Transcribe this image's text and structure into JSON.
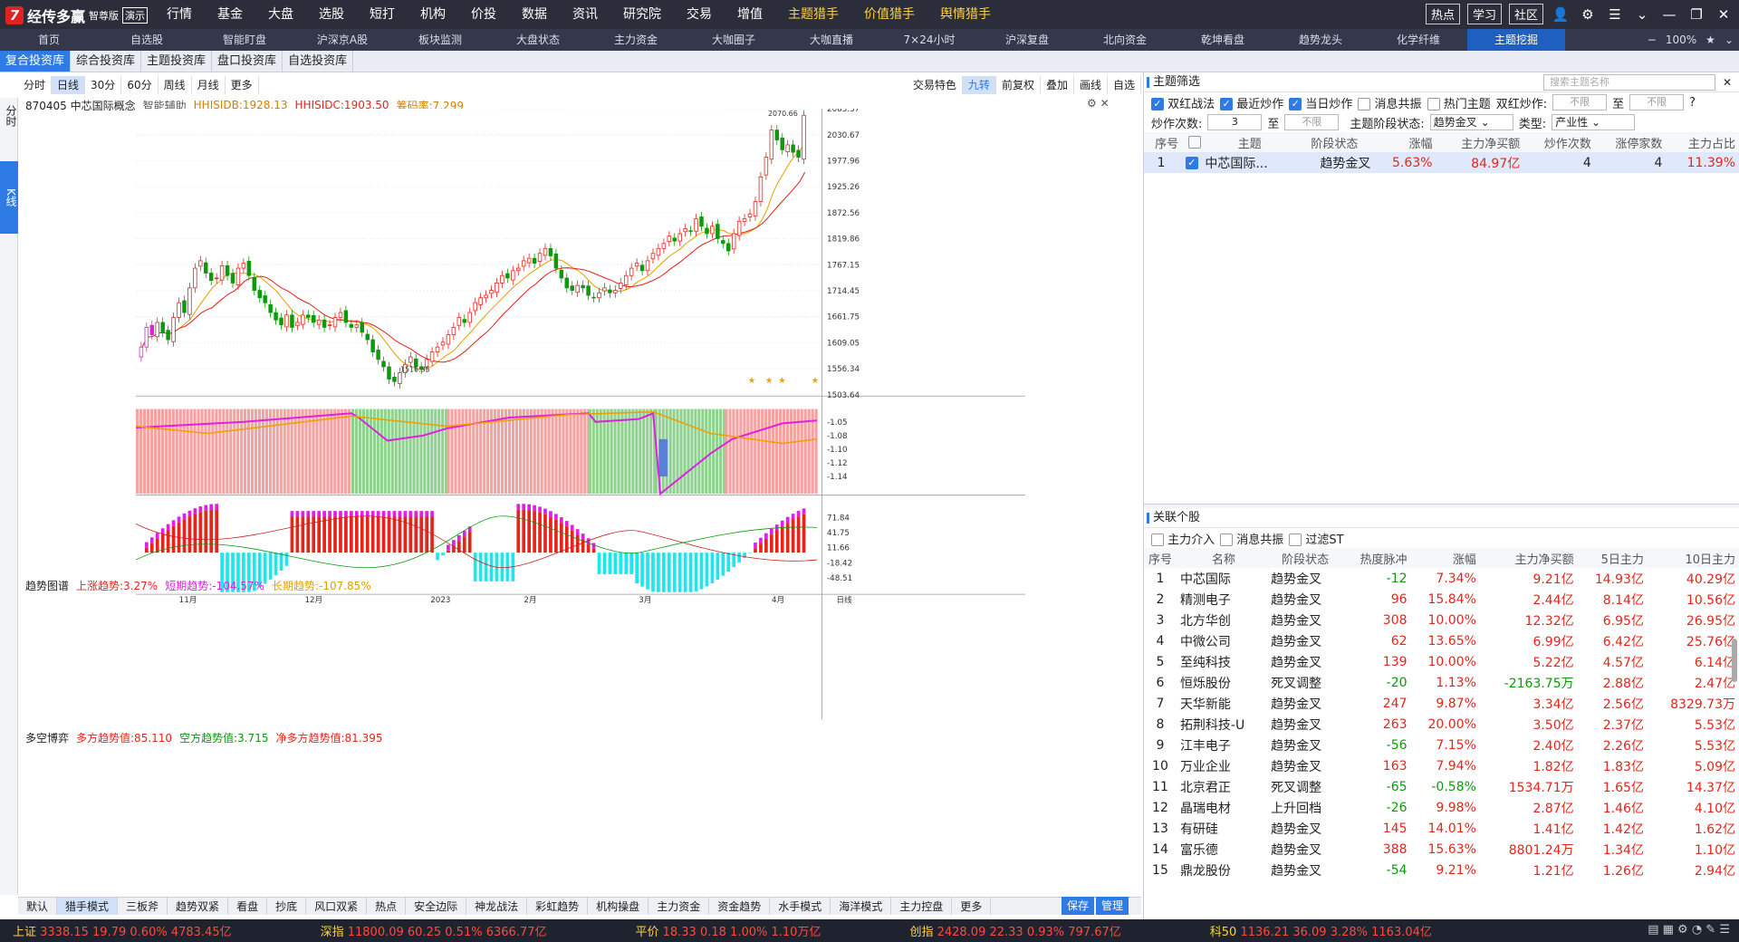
{
  "app": {
    "title": "经传多赢",
    "edition": "智尊版",
    "demo": "演示"
  },
  "topmenu": [
    "行情",
    "基金",
    "大盘",
    "选股",
    "短打",
    "机构",
    "价投",
    "数据",
    "资讯",
    "研究院",
    "交易",
    "增值",
    "主题猎手",
    "价值猎手",
    "舆情猎手"
  ],
  "topmenu_highlight": [
    "主题猎手",
    "价值猎手",
    "舆情猎手"
  ],
  "topright": [
    "热点",
    "学习",
    "社区"
  ],
  "navtabs": [
    "首页",
    "自选股",
    "智能盯盘",
    "沪深京A股",
    "板块监测",
    "大盘状态",
    "主力资金",
    "大咖圈子",
    "大咖直播",
    "7×24小时",
    "沪深复盘",
    "北向资金",
    "乾坤看盘",
    "趋势龙头",
    "化学纤维",
    "主题挖掘"
  ],
  "nav_zoom": "100%",
  "subtabs": [
    "复合投资库",
    "综合投资库",
    "主题投资库",
    "盘口投资库",
    "自选投资库"
  ],
  "side": {
    "tab1": "分时",
    "tab2": "K线"
  },
  "periods": [
    "分时",
    "日线",
    "30分",
    "60分",
    "周线",
    "月线",
    "更多"
  ],
  "active_period": "日线",
  "chart_tools": [
    "交易特色",
    "九转",
    "前复权",
    "叠加",
    "画线",
    "自选"
  ],
  "chart_info": {
    "code": "870405 中芯国际概念",
    "assist": "智能辅助",
    "l1": "HHJSJDB:1928.13",
    "l2": "HHJSJDC:1903.50",
    "l3": "筹码率:7.299"
  },
  "pane2": {
    "name": "趋势图谱",
    "l1": "上涨趋势:3.27%",
    "l2": "短期趋势:-104.57%",
    "l3": "长期趋势:-107.85%"
  },
  "pane3": {
    "name": "多空博弈",
    "l1": "多方趋势值:85.110",
    "l2": "空方趋势值:3.715",
    "l3": "净多方趋势值:81.395"
  },
  "price_axis": [
    "2083.37",
    "2030.67",
    "1977.96",
    "1925.26",
    "1872.56",
    "1819.86",
    "1767.15",
    "1714.45",
    "1661.75",
    "1609.05",
    "1556.34",
    "1503.64"
  ],
  "trend_axis": [
    "-1.05",
    "-1.08",
    "-1.10",
    "-1.12",
    "-1.14"
  ],
  "game_axis": [
    "71.84",
    "41.75",
    "11.66",
    "-18.42",
    "-48.51"
  ],
  "high_label": "2070.66",
  "low_label": "1516.35",
  "x_labels": [
    "11月",
    "12月",
    "2023",
    "2月",
    "3月",
    "4月"
  ],
  "x_mode": "日线",
  "bottomtabs": [
    "默认",
    "猎手模式",
    "三板斧",
    "趋势双紧",
    "看盘",
    "抄底",
    "风口双紧",
    "热点",
    "安全边际",
    "神龙战法",
    "彩虹趋势",
    "机构操盘",
    "主力资金",
    "资金趋势",
    "水手模式",
    "海洋模式",
    "主力控盘",
    "更多"
  ],
  "bottom_active": "猎手模式",
  "bottom_buttons": [
    "保存",
    "管理"
  ],
  "right": {
    "section1": "主题筛选",
    "search_placeholder": "搜索主题名称",
    "filters": [
      {
        "label": "双红战法",
        "on": true
      },
      {
        "label": "最近炒作",
        "on": true
      },
      {
        "label": "当日炒作",
        "on": true
      },
      {
        "label": "消息共振",
        "on": false
      },
      {
        "label": "热门主题",
        "on": false
      }
    ],
    "double_red": "双红炒作:",
    "none": "不限",
    "to": "至",
    "count_label": "炒作次数:",
    "count_value": "3",
    "stage_label": "主题阶段状态:",
    "stage_value": "趋势金叉",
    "type_label": "类型:",
    "type_value": "产业性",
    "theme_headers": [
      "序号",
      "",
      "主题",
      "阶段状态",
      "涨幅",
      "主力净买额",
      "炒作次数",
      "涨停家数",
      "主力占比"
    ],
    "theme_rows": [
      [
        "1",
        "",
        "中芯国际...",
        "趋势金叉",
        "5.63%",
        "84.97亿",
        "4",
        "4",
        "11.39%"
      ]
    ],
    "section2": "关联个股",
    "filters2": [
      {
        "label": "主力介入",
        "on": false
      },
      {
        "label": "消息共振",
        "on": false
      },
      {
        "label": "过滤ST",
        "on": false
      }
    ],
    "stock_headers": [
      "序号",
      "名称",
      "阶段状态",
      "热度脉冲",
      "涨幅",
      "主力净买额",
      "5日主力",
      "10日主力"
    ],
    "stock_rows": [
      [
        "1",
        "中芯国际",
        "趋势金叉",
        "-12",
        "7.34%",
        "9.21亿",
        "14.93亿",
        "40.29亿"
      ],
      [
        "2",
        "精测电子",
        "趋势金叉",
        "96",
        "15.84%",
        "2.44亿",
        "8.14亿",
        "10.56亿"
      ],
      [
        "3",
        "北方华创",
        "趋势金叉",
        "308",
        "10.00%",
        "12.32亿",
        "6.95亿",
        "26.95亿"
      ],
      [
        "4",
        "中微公司",
        "趋势金叉",
        "62",
        "13.65%",
        "6.99亿",
        "6.42亿",
        "25.76亿"
      ],
      [
        "5",
        "至纯科技",
        "趋势金叉",
        "139",
        "10.00%",
        "5.22亿",
        "4.57亿",
        "6.14亿"
      ],
      [
        "6",
        "恒烁股份",
        "死叉调整",
        "-20",
        "1.13%",
        "-2163.75万",
        "2.88亿",
        "2.47亿"
      ],
      [
        "7",
        "天华新能",
        "趋势金叉",
        "247",
        "9.87%",
        "3.34亿",
        "2.56亿",
        "8329.73万"
      ],
      [
        "8",
        "拓荆科技-U",
        "趋势金叉",
        "263",
        "20.00%",
        "3.50亿",
        "2.37亿",
        "5.53亿"
      ],
      [
        "9",
        "江丰电子",
        "趋势金叉",
        "-56",
        "7.15%",
        "2.40亿",
        "2.26亿",
        "5.53亿"
      ],
      [
        "10",
        "万业企业",
        "趋势金叉",
        "163",
        "7.94%",
        "1.82亿",
        "1.83亿",
        "5.09亿"
      ],
      [
        "11",
        "北京君正",
        "死叉调整",
        "-65",
        "-0.58%",
        "1534.71万",
        "1.65亿",
        "14.37亿"
      ],
      [
        "12",
        "晶瑞电材",
        "上升回档",
        "-26",
        "9.98%",
        "2.87亿",
        "1.46亿",
        "4.10亿"
      ],
      [
        "13",
        "有研硅",
        "趋势金叉",
        "145",
        "14.01%",
        "1.41亿",
        "1.42亿",
        "1.62亿"
      ],
      [
        "14",
        "富乐德",
        "趋势金叉",
        "388",
        "15.63%",
        "8801.24万",
        "1.34亿",
        "1.10亿"
      ],
      [
        "15",
        "鼎龙股份",
        "趋势金叉",
        "-54",
        "9.21%",
        "1.21亿",
        "1.26亿",
        "2.94亿"
      ]
    ]
  },
  "status": [
    {
      "name": "上证",
      "price": "3338.15",
      "chg": "19.79",
      "pct": "0.60%",
      "amt": "4783.45亿",
      "c": "red"
    },
    {
      "name": "深指",
      "price": "11800.09",
      "chg": "60.25",
      "pct": "0.51%",
      "amt": "6366.77亿",
      "c": "red"
    },
    {
      "name": "平价",
      "price": "18.33",
      "chg": "0.18",
      "pct": "1.00%",
      "amt": "1.10万亿",
      "c": "red"
    },
    {
      "name": "创指",
      "price": "2428.09",
      "chg": "22.33",
      "pct": "0.93%",
      "amt": "797.67亿",
      "c": "red"
    },
    {
      "name": "科50",
      "price": "1136.21",
      "chg": "36.09",
      "pct": "3.28%",
      "amt": "1163.04亿",
      "c": "red"
    }
  ],
  "chart_data": {
    "type": "candlestick",
    "y_range": [
      1503.64,
      2083.37
    ],
    "closes": [
      1600,
      1640,
      1625,
      1650,
      1630,
      1615,
      1660,
      1690,
      1670,
      1720,
      1760,
      1775,
      1750,
      1735,
      1740,
      1765,
      1745,
      1730,
      1760,
      1770,
      1745,
      1715,
      1700,
      1690,
      1670,
      1655,
      1645,
      1665,
      1640,
      1650,
      1665,
      1660,
      1650,
      1655,
      1640,
      1645,
      1660,
      1670,
      1650,
      1640,
      1645,
      1630,
      1615,
      1590,
      1575,
      1560,
      1535,
      1530,
      1548,
      1565,
      1580,
      1560,
      1555,
      1575,
      1590,
      1600,
      1610,
      1625,
      1640,
      1660,
      1650,
      1670,
      1690,
      1700,
      1705,
      1715,
      1730,
      1745,
      1740,
      1755,
      1760,
      1775,
      1780,
      1770,
      1790,
      1800,
      1785,
      1760,
      1740,
      1720,
      1715,
      1725,
      1720,
      1705,
      1700,
      1710,
      1720,
      1710,
      1715,
      1730,
      1745,
      1760,
      1770,
      1755,
      1775,
      1790,
      1800,
      1810,
      1825,
      1815,
      1830,
      1840,
      1835,
      1860,
      1845,
      1830,
      1845,
      1820,
      1810,
      1795,
      1830,
      1855,
      1860,
      1870,
      1895,
      1945,
      1985,
      2040,
      2020,
      2000,
      2010,
      1995,
      1985,
      2070
    ]
  }
}
